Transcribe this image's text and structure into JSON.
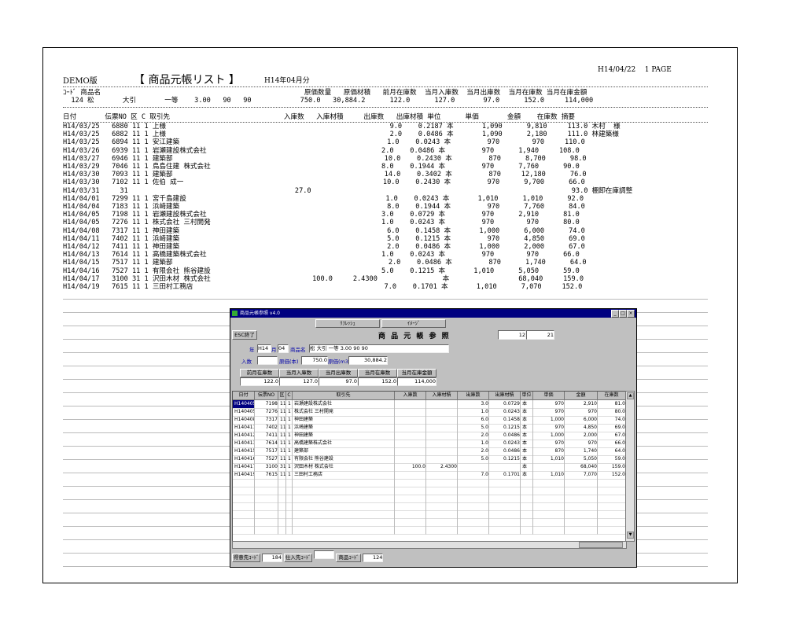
{
  "report": {
    "demo": "DEMO版",
    "title": "【 商品元帳リスト 】",
    "month": "H14年04月分",
    "date": "H14/04/22",
    "page": "1 PAGE",
    "sum_header": "ｺｰﾄﾞ 商品名                                                  原価数量   原価材積   前月在庫数  当月入庫数  当月出庫数  当月在庫数 当月在庫金額",
    "sum_values": "  124 松       大引       一等    3.00   90   90            750.0   30,884.2      122.0      127.0       97.0      152.0     114,000",
    "col_header": "日付       伝票NO 区 C 取引先                            入庫数   入庫材積     出庫数   出庫材積 単位      単価       金額    在庫数 摘要",
    "rows": [
      "H14/03/25   6880 11 1 上様                                                       9.0    0.2187 本       1,090      9,810     113.0 木村  様",
      "H14/03/25   6882 11 1 上様                                                       2.0    0.0486 本       1,090      2,180     111.0 林建築様",
      "H14/03/25   6894 11 1 安江建築                                                   1.0    0.0243 本         970        970     110.0",
      "H14/03/26   6939 11 1 岩瀬建設株式会社                                           2.0    0.0486 本         970      1,940     108.0",
      "H14/03/27   6946 11 1 建築部                                                    10.0    0.2430 本         870      8,700      98.0",
      "H14/03/29   7046 11 1 鳥島住建 株式会社                                          8.0    0.1944 本         970      7,760      90.0",
      "H14/03/30   7093 11 1 建築部                                                    14.0    0.3402 本         870     12,180      76.0",
      "H14/03/30   7102 11 1 佐伯 成一                                                 10.0    0.2430 本         970      9,700      66.0",
      "H14/03/31     31                                         27.0                                                                93.0 棚卸在庫調整",
      "H14/04/01   7299 11 1 宮千島建設                                                 1.0    0.0243 本       1,010      1,010      92.0",
      "H14/04/04   7183 11 1 浜崎建築                                                   8.0    0.1944 本         970      7,760      84.0",
      "H14/04/05   7198 11 1 岩瀬建設株式会社                                           3.0    0.0729 本         970      2,910      81.0",
      "H14/04/05   7276 11 1 株式会社 三村開発                                          1.0    0.0243 本         970        970      80.0",
      "H14/04/08   7317 11 1 神田建築                                                   6.0    0.1458 本       1,000      6,000      74.0",
      "H14/04/11   7402 11 1 浜崎建築                                                   5.0    0.1215 本         970      4,850      69.0",
      "H14/04/12   7411 11 1 神田建築                                                   2.0    0.0486 本       1,000      2,000      67.0",
      "H14/04/13   7614 11 1 高橋建築株式会社                                           1.0    0.0243 本         970        970      66.0",
      "H14/04/15   7517 11 1 建築部                                                     2.0    0.0486 本         870      1,740      64.0",
      "H14/04/16   7527 11 1 有限会社 熊谷建設                                          5.0    0.1215 本       1,010      5,050      59.0",
      "H14/04/17   3100 31 1 沢田木材 株式会社                         100.0     2.4300                本                 68,040     159.0",
      "H14/04/19   7615 11 1 三田村工務店                                               7.0    0.1701 本       1,010      7,070     152.0"
    ]
  },
  "window": {
    "title": "商品元帳参照  v4.0",
    "refresh": "ﾘﾌﾚｯｼｭ",
    "image": "ｲﾒｰｼﾞ",
    "esc": "ESC終了",
    "heading": "商 品 元 帳 参 照",
    "counter_a": "12",
    "counter_b": "21",
    "year_lbl": "年",
    "year": "H14",
    "month_lbl": "月",
    "month": "04",
    "prod_lbl": "商品名",
    "prod": "松        大引        一等      3.00   90   90",
    "nyuko_lbl": "入数",
    "genka_lbl": "原価(本)",
    "genka": "750.0",
    "zaiseki_lbl": "原価(m3)",
    "zaiseki": "30,884.2",
    "sum_heads": [
      "前月在庫数",
      "当月入庫数",
      "当月出庫数",
      "当月在庫数",
      "当月在庫金額"
    ],
    "sum_vals": [
      "122.0",
      "127.0",
      "97.0",
      "152.0",
      "114,000"
    ],
    "grid_heads": [
      "日付",
      "伝票NO",
      "区",
      "C",
      "取引先",
      "入庫数",
      "入庫材積",
      "出庫数",
      "出庫材積",
      "単位",
      "単価",
      "金額",
      "在庫数"
    ],
    "grid_rows": [
      [
        "H140405",
        "7198",
        "11",
        "1",
        "岩瀬建設株式会社",
        "",
        "",
        "3.0",
        "0.0729",
        "本",
        "970",
        "2,910",
        "81.0"
      ],
      [
        "H140405",
        "7276",
        "11",
        "1",
        "株式会社 三村開発",
        "",
        "",
        "1.0",
        "0.0243",
        "本",
        "970",
        "970",
        "80.0"
      ],
      [
        "H140408",
        "7317",
        "11",
        "1",
        "神田建築",
        "",
        "",
        "6.0",
        "0.1458",
        "本",
        "1,000",
        "6,000",
        "74.0"
      ],
      [
        "H140411",
        "7402",
        "11",
        "1",
        "浜崎建築",
        "",
        "",
        "5.0",
        "0.1215",
        "本",
        "970",
        "4,850",
        "69.0"
      ],
      [
        "H140412",
        "7411",
        "11",
        "1",
        "神田建築",
        "",
        "",
        "2.0",
        "0.0486",
        "本",
        "1,000",
        "2,000",
        "67.0"
      ],
      [
        "H140413",
        "7614",
        "11",
        "1",
        "高橋建築株式会社",
        "",
        "",
        "1.0",
        "0.0243",
        "本",
        "970",
        "970",
        "66.0"
      ],
      [
        "H140415",
        "7517",
        "11",
        "1",
        "建築部",
        "",
        "",
        "2.0",
        "0.0486",
        "本",
        "870",
        "1,740",
        "64.0"
      ],
      [
        "H140416",
        "7527",
        "11",
        "1",
        "有限会社 熊谷建設",
        "",
        "",
        "5.0",
        "0.1215",
        "本",
        "1,010",
        "5,050",
        "59.0"
      ],
      [
        "H140417",
        "3100",
        "31",
        "1",
        "沢田木材 株式会社",
        "100.0",
        "2.4300",
        "",
        "",
        "本",
        "",
        "68,040",
        "159.0"
      ],
      [
        "H140419",
        "7615",
        "11",
        "1",
        "三田村工務店",
        "",
        "",
        "7.0",
        "0.1701",
        "本",
        "1,010",
        "7,070",
        "152.0"
      ]
    ],
    "status_a_lbl": "得意先ｺｰﾄﾞ",
    "status_a": "184",
    "status_b_lbl": "仕入先ｺｰﾄﾞ",
    "status_c_lbl": "商品ｺｰﾄﾞ",
    "status_c": "124"
  }
}
